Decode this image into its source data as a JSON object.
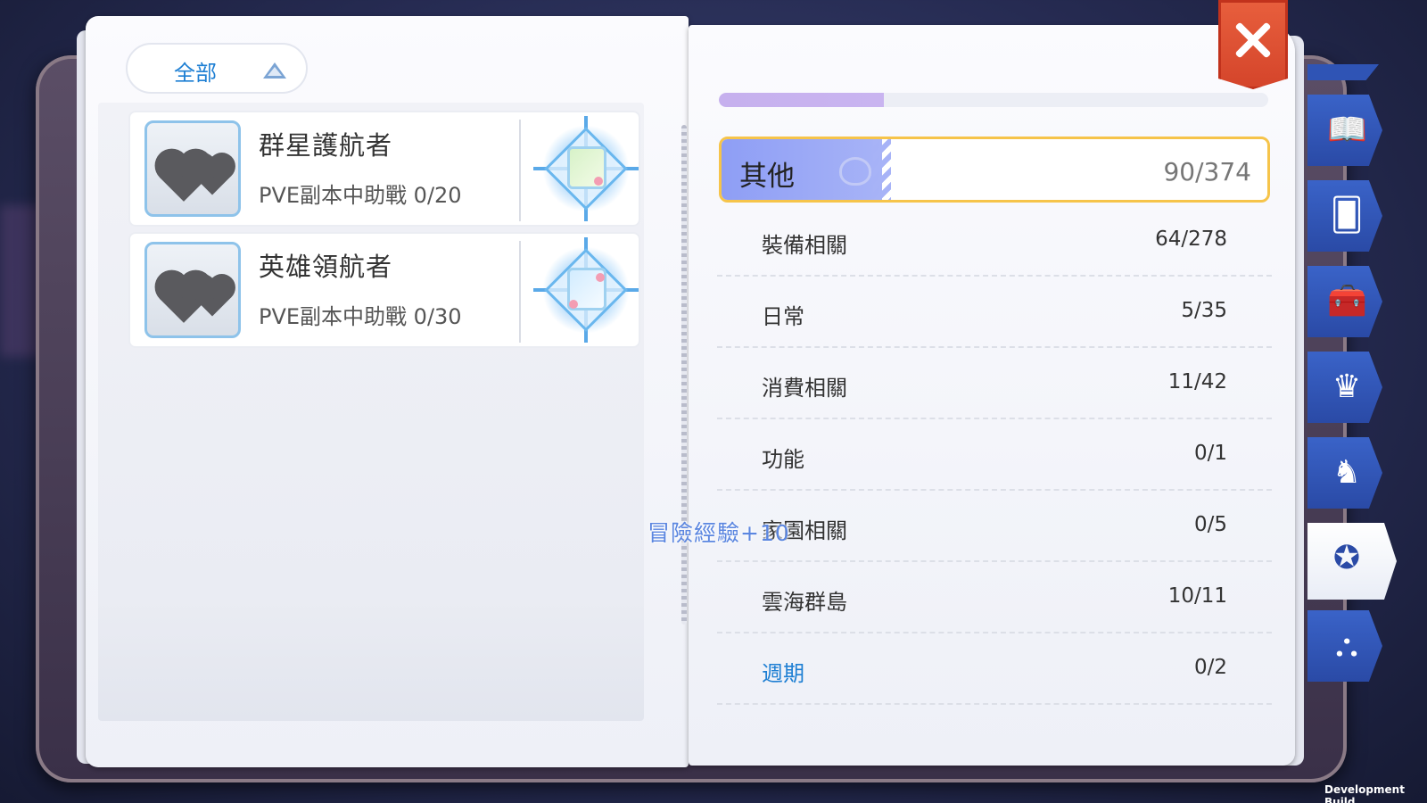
{
  "filter": {
    "label": "全部"
  },
  "achievements": [
    {
      "title": "群星護航者",
      "description": "PVE副本中助戰 0/20"
    },
    {
      "title": "英雄領航者",
      "description": "PVE副本中助戰 0/30"
    }
  ],
  "category_header": {
    "name": "其他",
    "count": "90/374"
  },
  "category_progress": 0.3,
  "subcategories": [
    {
      "label": "裝備相關",
      "value": "64/278"
    },
    {
      "label": "日常",
      "value": "5/35"
    },
    {
      "label": "消費相關",
      "value": "11/42"
    },
    {
      "label": "功能",
      "value": "0/1"
    },
    {
      "label": "家園相關",
      "value": "0/5"
    },
    {
      "label": "雲海群島",
      "value": "10/11"
    },
    {
      "label": "週期",
      "value": "0/2"
    }
  ],
  "float_text": "冒險經驗+10",
  "side_tabs": [
    {
      "name": "book-icon",
      "glyph": "📖"
    },
    {
      "name": "card-icon",
      "glyph": "🂠"
    },
    {
      "name": "toolbox-icon",
      "glyph": "🧰"
    },
    {
      "name": "chair-icon",
      "glyph": "♛"
    },
    {
      "name": "rocking-horse-icon",
      "glyph": "♞"
    },
    {
      "name": "medal-icon",
      "glyph": "✪"
    },
    {
      "name": "hierarchy-icon",
      "glyph": "⛬"
    }
  ],
  "dev_build": "Development Build",
  "colors": {
    "accent": "#1e7fd3",
    "close": "#d4442a",
    "tab": "#2a4aa6",
    "highlight": "#f6c44a"
  }
}
